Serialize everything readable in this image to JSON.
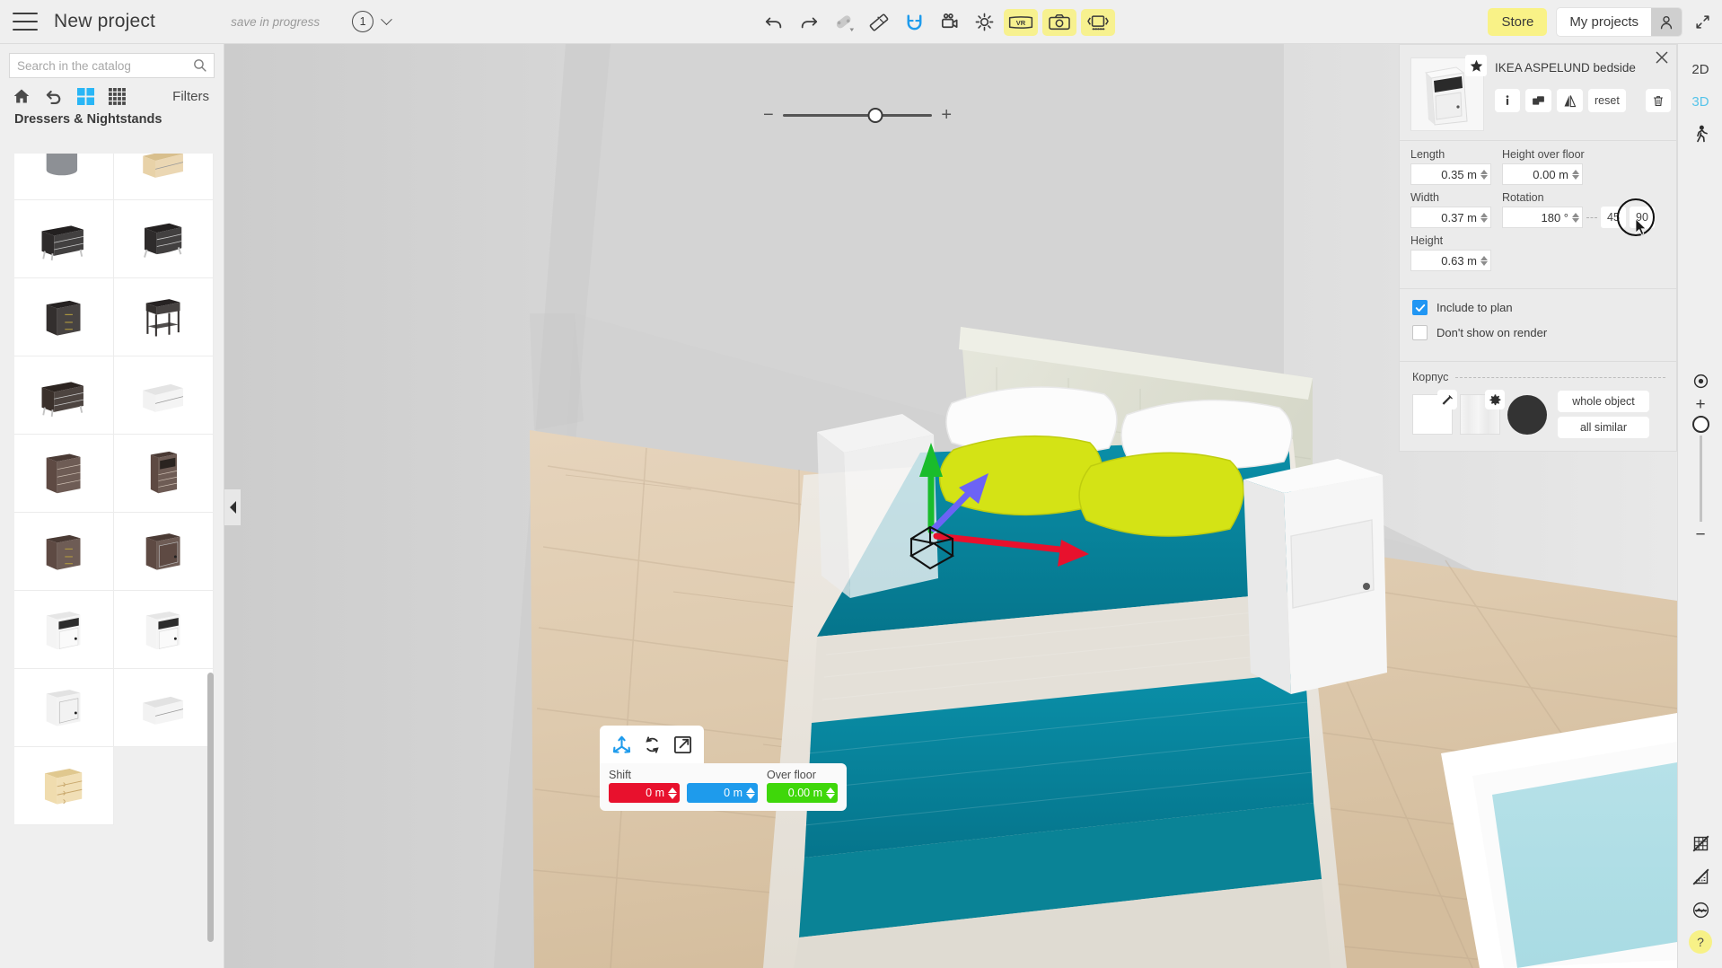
{
  "header": {
    "menu_icon": "hamburger-menu-icon",
    "project_title": "New project",
    "save_status": "save in progress",
    "floor_number": "1",
    "tools": [
      {
        "name": "undo-tool",
        "icon": "undo-icon",
        "yellow": false
      },
      {
        "name": "redo-tool",
        "icon": "redo-icon",
        "yellow": false
      },
      {
        "name": "eraser-tool",
        "icon": "eraser-icon",
        "yellow": false
      },
      {
        "name": "ruler-tool",
        "icon": "ruler-icon",
        "yellow": false
      },
      {
        "name": "magnet-tool",
        "icon": "magnet-icon",
        "yellow": false
      },
      {
        "name": "video-tool",
        "icon": "video-camera-icon",
        "yellow": false
      },
      {
        "name": "lighting-tool",
        "icon": "sun-icon",
        "yellow": false
      },
      {
        "name": "vr-tool",
        "icon": "vr-icon",
        "yellow": true
      },
      {
        "name": "photo-tool",
        "icon": "photo-camera-icon",
        "yellow": true
      },
      {
        "name": "panorama-tool",
        "icon": "panorama-icon",
        "yellow": true
      }
    ],
    "store_label": "Store",
    "my_projects_label": "My projects",
    "avatar_icon": "user-avatar-icon",
    "fullscreen_icon": "expand-diagonal-icon"
  },
  "catalog": {
    "search_placeholder": "Search in the catalog",
    "search_value": "",
    "search_icon": "search-icon",
    "tools": [
      {
        "name": "catalog-home",
        "icon": "home-icon",
        "active": false
      },
      {
        "name": "catalog-back",
        "icon": "undo-arrow-icon",
        "active": false
      },
      {
        "name": "catalog-large-grid",
        "icon": "large-grid-icon",
        "active": true
      },
      {
        "name": "catalog-small-grid",
        "icon": "small-grid-icon",
        "active": false
      }
    ],
    "filters_label": "Filters",
    "category_heading": "Dressers & Nightstands",
    "items": [
      {
        "name": "item-grey-cylinder-stand",
        "kind": "cylinder",
        "color": "#8d9095",
        "top": "#6e7177"
      },
      {
        "name": "item-beech-low-drawer",
        "kind": "drawer2",
        "color": "#e8d2a8",
        "top": "#d8bf8d"
      },
      {
        "name": "item-black-dresser-3dr",
        "kind": "dresser3",
        "color": "#2e2b2b",
        "top": "#232020"
      },
      {
        "name": "item-black-bombe-chest",
        "kind": "bombe",
        "color": "#2e2b2b",
        "top": "#232020"
      },
      {
        "name": "item-dark-nightstand-drw",
        "kind": "night",
        "color": "#332f2e",
        "top": "#262222"
      },
      {
        "name": "item-dark-side-table-legs",
        "kind": "legtable",
        "color": "#332f2e",
        "top": "#262222"
      },
      {
        "name": "item-espresso-dresser",
        "kind": "dresser3",
        "color": "#3a302b",
        "top": "#2c2420"
      },
      {
        "name": "item-white-low-cabinet",
        "kind": "drawer2",
        "color": "#f2f2f2",
        "top": "#e4e4e4"
      },
      {
        "name": "item-brown-tall-chest",
        "kind": "tall4",
        "color": "#5e4a43",
        "top": "#4a3a34"
      },
      {
        "name": "item-brown-narrow-chest",
        "kind": "narrow5",
        "color": "#5e4a43",
        "top": "#4a3a34"
      },
      {
        "name": "item-brown-nightstand-3dr",
        "kind": "night",
        "color": "#5e4a43",
        "top": "#4a3a34"
      },
      {
        "name": "item-brown-cabinet-door",
        "kind": "cabinet",
        "color": "#5e4a43",
        "top": "#4a3a34"
      },
      {
        "name": "item-white-aspelund-left",
        "kind": "aspelund",
        "color": "#f4f4f4",
        "top": "#e6e6e6"
      },
      {
        "name": "item-white-aspelund-right",
        "kind": "aspelund",
        "color": "#f4f4f4",
        "top": "#e6e6e6"
      },
      {
        "name": "item-white-nightstand-dr",
        "kind": "cabinet",
        "color": "#f2f2f2",
        "top": "#e2e2e2"
      },
      {
        "name": "item-white-nightstand-2dr",
        "kind": "drawer2",
        "color": "#f2f2f2",
        "top": "#e2e2e2"
      },
      {
        "name": "item-birch-3drawer-chest",
        "kind": "tall3",
        "color": "#f0dcae",
        "top": "#e0c88f"
      }
    ],
    "collapse_icon": "collapse-left-arrow-icon"
  },
  "viewport": {
    "zoom_slider": {
      "minus": "−",
      "plus": "+",
      "value_pct": 62
    },
    "gizmo": {
      "x_axis_color": "#e8112d",
      "y_axis_color": "#1abc2c",
      "z_axis_color": "#6c63f5"
    },
    "move_panel": {
      "modes": [
        {
          "name": "move-mode",
          "icon": "move-axes-icon",
          "active": true
        },
        {
          "name": "rotate-mode",
          "icon": "rotate-icon",
          "active": false
        },
        {
          "name": "resize-mode",
          "icon": "resize-icon",
          "active": false
        }
      ],
      "shift_label": "Shift",
      "over_floor_label": "Over floor",
      "shift_x": "0 m",
      "shift_y": "0 m",
      "over_floor": "0.00 m"
    }
  },
  "properties": {
    "close_icon": "close-icon",
    "object_name": "IKEA ASPELUND bedside",
    "favorite_icon": "star-icon",
    "thumbnail_name": "object-thumbnail",
    "actions": [
      {
        "name": "info-action",
        "icon": "info-icon",
        "label": ""
      },
      {
        "name": "clone-action",
        "icon": "duplicate-icon",
        "label": ""
      },
      {
        "name": "mirror-action",
        "icon": "mirror-icon",
        "label": ""
      },
      {
        "name": "reset-action",
        "icon": "",
        "label": "reset"
      },
      {
        "name": "delete-action",
        "icon": "trash-icon",
        "label": ""
      }
    ],
    "fields": [
      {
        "name": "length-field",
        "label": "Length",
        "value": "0.35 m"
      },
      {
        "name": "height-over-floor-field",
        "label": "Height over floor",
        "value": "0.00 m"
      },
      {
        "name": "width-field",
        "label": "Width",
        "value": "0.37 m"
      },
      {
        "name": "rotation-field",
        "label": "Rotation",
        "value": "180 °"
      },
      {
        "name": "height-field",
        "label": "Height",
        "value": "0.63 m"
      }
    ],
    "rotation_quick": [
      {
        "name": "rotate-45-button",
        "label": "45"
      },
      {
        "name": "rotate-90-button",
        "label": "90"
      }
    ],
    "checkboxes": [
      {
        "name": "include-to-plan-checkbox",
        "label": "Include to plan",
        "checked": true
      },
      {
        "name": "dont-show-on-render-checkbox",
        "label": "Don't show on render",
        "checked": false
      }
    ],
    "material": {
      "group_name": "Корпус",
      "color_swatch": "#ffffff",
      "texture_swatch": "#f2f2f2",
      "circle_swatch": "#333333",
      "eyedropper_icon": "eyedropper-icon",
      "gear_icon": "gear-icon",
      "whole_object_label": "whole object",
      "all_similar_label": "all similar"
    }
  },
  "rail": {
    "view_modes": [
      {
        "name": "view-2d-button",
        "label": "2D",
        "active": false
      },
      {
        "name": "view-3d-button",
        "label": "3D",
        "active": true
      }
    ],
    "walk_icon": "walking-person-icon",
    "zoom": {
      "center_icon": "center-view-icon",
      "plus": "+",
      "minus": "−",
      "knob_icon": "zoom-knob-icon"
    },
    "bottom_icons": [
      {
        "name": "hide-grid-icon"
      },
      {
        "name": "hide-measurements-icon"
      },
      {
        "name": "hide-ceiling-icon"
      }
    ],
    "help_label": "?"
  }
}
